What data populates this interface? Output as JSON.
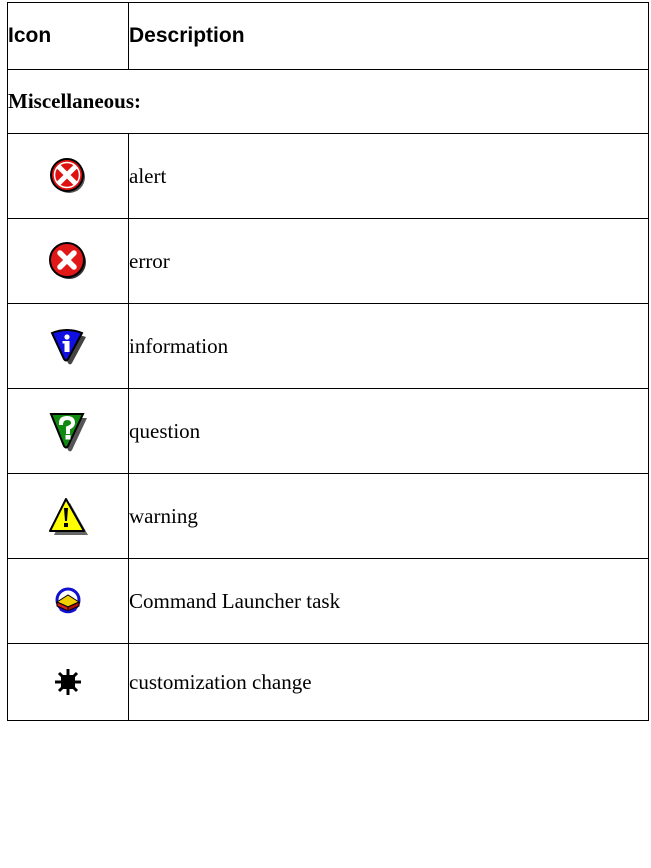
{
  "table": {
    "headers": {
      "icon": "Icon",
      "description": "Description"
    },
    "section_label": "Miscellaneous:",
    "rows": [
      {
        "icon": "alert-icon",
        "description": "alert"
      },
      {
        "icon": "error-icon",
        "description": "error"
      },
      {
        "icon": "information-icon",
        "description": "information"
      },
      {
        "icon": "question-icon",
        "description": "question"
      },
      {
        "icon": "warning-icon",
        "description": "warning"
      },
      {
        "icon": "command-launcher-task-icon",
        "description": "Command Launcher task"
      },
      {
        "icon": "customization-change-icon",
        "description": "customization change"
      }
    ]
  },
  "colors": {
    "alert_red": "#e01010",
    "error_red": "#e01818",
    "info_blue": "#1010e0",
    "question_green": "#108a10",
    "warning_yellow": "#ffff00"
  }
}
